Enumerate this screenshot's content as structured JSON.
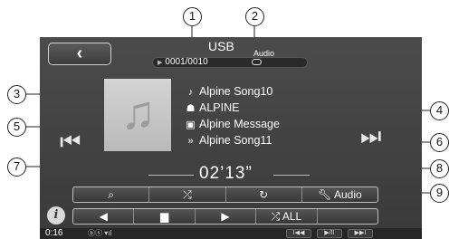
{
  "callouts": [
    "1",
    "2",
    "3",
    "4",
    "5",
    "6",
    "7",
    "8",
    "9"
  ],
  "header": {
    "back_label": "‹",
    "source_title": "USB",
    "source_subtitle": "Audio",
    "track_counter": "0001/0010"
  },
  "track": {
    "song": "Alpine Song10",
    "artist": "ALPINE",
    "album": "Alpine Message",
    "next_song": "Alpine Song11",
    "elapsed": "02’13”"
  },
  "buttons": {
    "search": "⌕",
    "shuffle": "⤮",
    "repeat": "↻",
    "audio": "Audio",
    "prev_folder": "◀",
    "folder": "▆",
    "next_folder": "▶",
    "shuffle_all": "⤮ ALL",
    "info": "i",
    "prev_track": "⏮",
    "next_track": "⏭",
    "mini_prev": "I◀◀",
    "mini_play": "▶/II",
    "mini_next": "▶▶I"
  },
  "status": {
    "clock": "0:16",
    "icons": "ⓑⓢ ▾ıl"
  },
  "icons": {
    "song": "music-note-icon",
    "artist": "artist-icon",
    "album": "album-icon",
    "next": "next-song-icon"
  }
}
